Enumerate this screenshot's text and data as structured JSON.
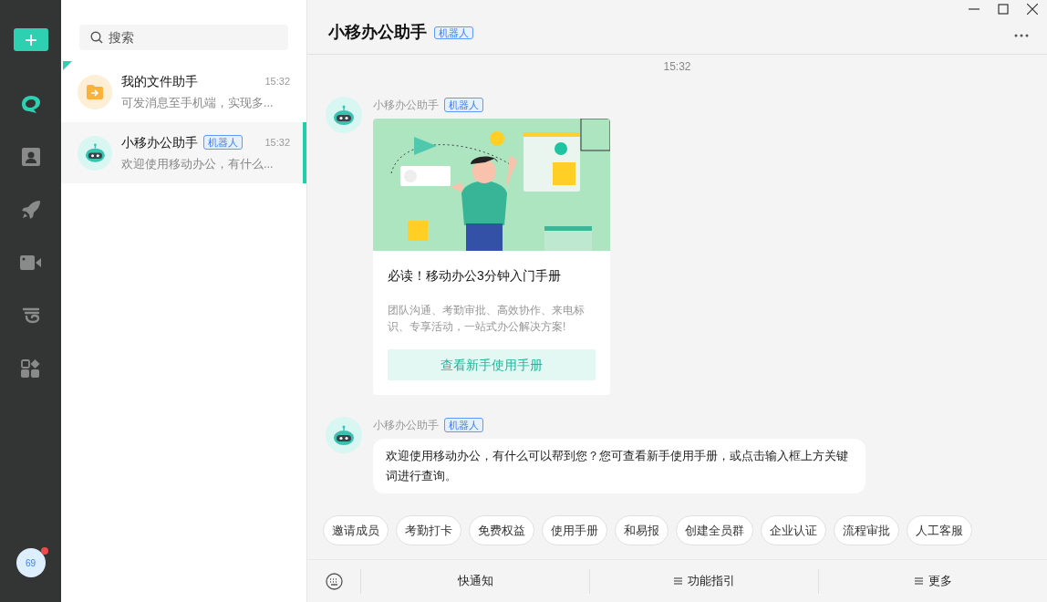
{
  "rail": {
    "items": [
      {
        "kind": "chat",
        "selected": true
      },
      {
        "kind": "contacts",
        "selected": false
      },
      {
        "kind": "rocket",
        "selected": false
      },
      {
        "kind": "video",
        "selected": false
      },
      {
        "kind": "cloud",
        "selected": false
      },
      {
        "kind": "apps",
        "selected": false
      }
    ],
    "avatar": {
      "text": "69",
      "notification": true
    }
  },
  "search": {
    "placeholder": "搜索"
  },
  "conversations": [
    {
      "kind": "file",
      "name": "我的文件助手",
      "time": "15:32",
      "preview": "可发消息至手机端，实现多...",
      "pinned": true,
      "selected": false
    },
    {
      "kind": "bot",
      "name": "小移办公助手",
      "badge": "机器人",
      "time": "15:32",
      "preview": "欢迎使用移动办公，有什么...",
      "pinned": false,
      "selected": true
    }
  ],
  "chat": {
    "title": "小移办公助手",
    "badge": "机器人",
    "timestamp": "15:32",
    "messages": [
      {
        "kind": "card",
        "sender": "小移办公助手",
        "badge": "机器人",
        "title": "必读！移动办公3分钟入门手册",
        "description": "团队沟通、考勤审批、高效协作、来电标识、专享活动，一站式办公解决方案!",
        "action": "查看新手使用手册"
      },
      {
        "kind": "text",
        "sender": "小移办公助手",
        "badge": "机器人",
        "text": "欢迎使用移动办公，有什么可以帮到您？您可查看新手使用手册，或点击输入框上方关键词进行查询。"
      }
    ],
    "quick_replies": [
      "邀请成员",
      "考勤打卡",
      "免费权益",
      "使用手册",
      "和易报",
      "创建全员群",
      "企业认证",
      "流程审批",
      "人工客服"
    ],
    "bottom_bar": [
      {
        "kind": "plain",
        "label": "快通知"
      },
      {
        "kind": "menu",
        "label": "功能指引"
      },
      {
        "kind": "menu",
        "label": "更多"
      }
    ]
  }
}
